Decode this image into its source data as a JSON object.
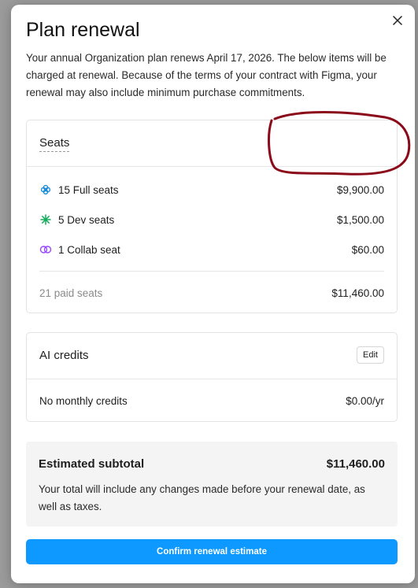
{
  "modal": {
    "title": "Plan renewal",
    "description": "Your annual Organization plan renews April 17, 2026. The below items will be charged at renewal. Because of the terms of your contract with Figma, your renewal may also include minimum purchase commitments."
  },
  "seats": {
    "title": "Seats",
    "items": [
      {
        "label": "15 Full seats",
        "value": "$9,900.00",
        "icon": "full-seat-icon",
        "color": "#1a8cd8"
      },
      {
        "label": "5 Dev seats",
        "value": "$1,500.00",
        "icon": "dev-seat-icon",
        "color": "#14ae5c"
      },
      {
        "label": "1 Collab seat",
        "value": "$60.00",
        "icon": "collab-seat-icon",
        "color": "#9747ff"
      }
    ],
    "total_label": "21 paid seats",
    "total_value": "$11,460.00"
  },
  "ai_credits": {
    "title": "AI credits",
    "edit_label": "Edit",
    "row_label": "No monthly credits",
    "row_value": "$0.00/yr"
  },
  "subtotal": {
    "title": "Estimated subtotal",
    "amount": "$11,460.00",
    "note": "Your total will include any changes made before your renewal date, as well as taxes."
  },
  "confirm_label": "Confirm renewal estimate",
  "colors": {
    "accent": "#0d99ff",
    "annotation": "#8b0a1a"
  }
}
